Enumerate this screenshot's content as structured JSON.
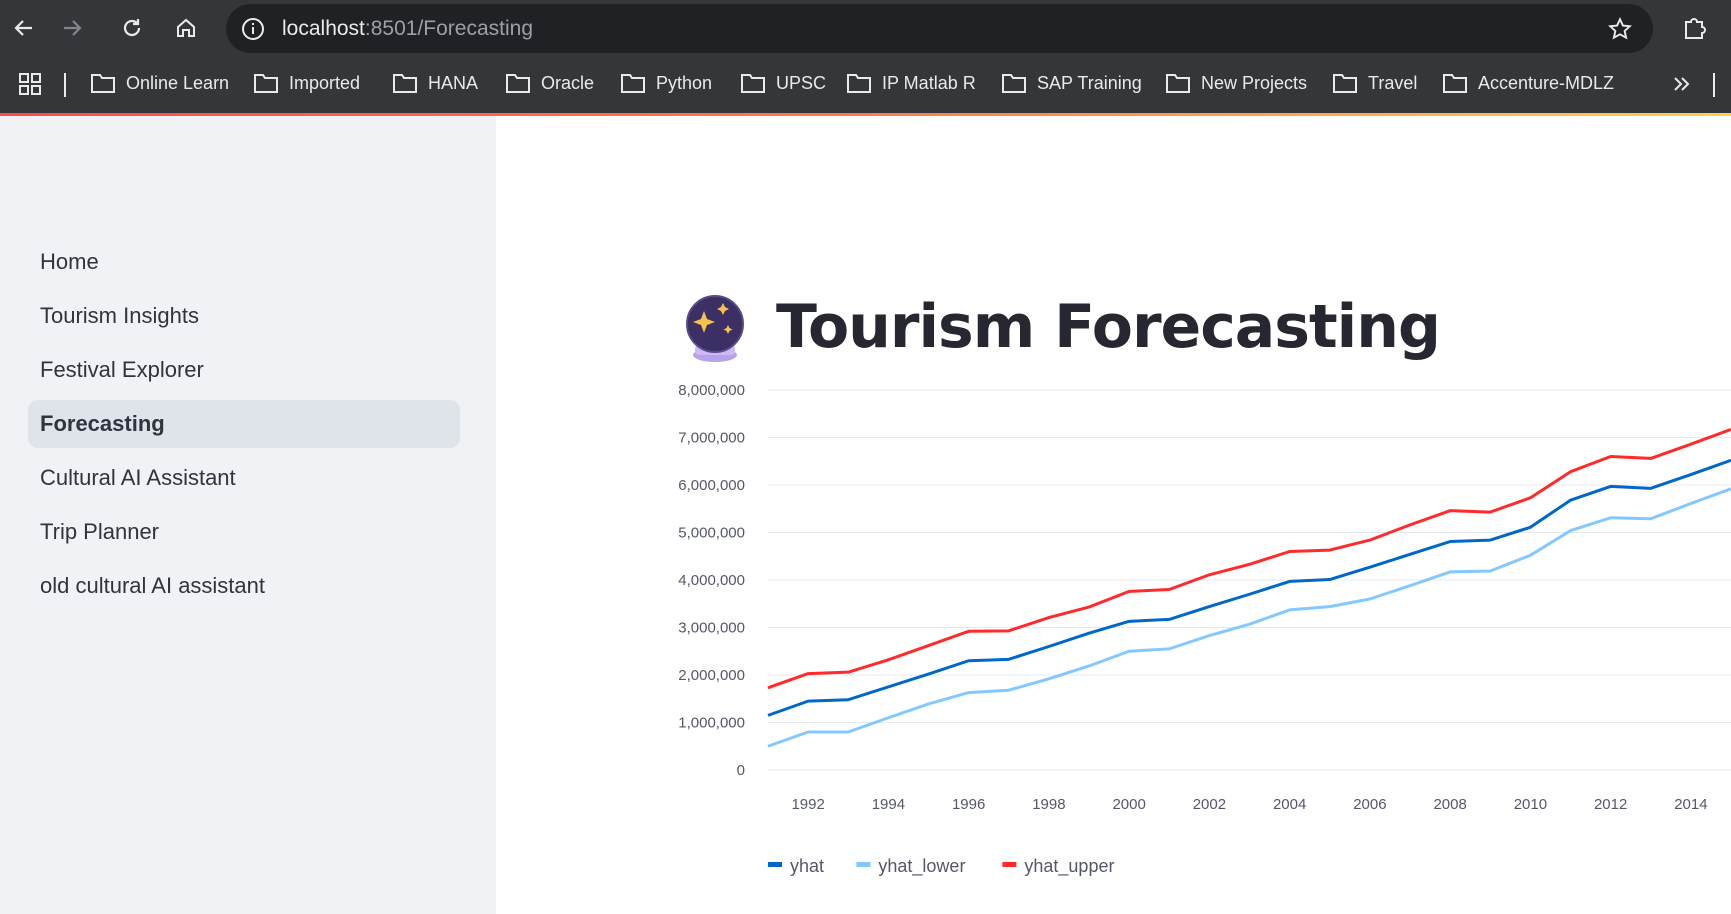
{
  "browser": {
    "url_host": "localhost",
    "url_rest": ":8501/Forecasting",
    "bookmarks": [
      "Online Learn",
      "Imported",
      "HANA",
      "Oracle",
      "Python",
      "UPSC",
      "IP Matlab R",
      "SAP Training",
      "New Projects",
      "Travel",
      "Accenture-MDLZ"
    ]
  },
  "sidebar": {
    "items": [
      {
        "label": "Home",
        "active": false
      },
      {
        "label": "Tourism Insights",
        "active": false
      },
      {
        "label": "Festival Explorer",
        "active": false
      },
      {
        "label": "Forecasting",
        "active": true
      },
      {
        "label": "Cultural AI Assistant",
        "active": false
      },
      {
        "label": "Trip Planner",
        "active": false
      },
      {
        "label": "old cultural AI assistant",
        "active": false
      }
    ]
  },
  "page": {
    "title": "Tourism Forecasting",
    "title_icon": "crystal-ball-icon"
  },
  "colors": {
    "yhat": "#0068c9",
    "yhat_lower": "#83c9ff",
    "yhat_upper": "#ff2b2b",
    "sidebar_bg": "#f0f2f6",
    "active_item_bg": "#dfe3ea"
  },
  "chart_data": {
    "type": "line",
    "x_ticks": [
      "1992",
      "1994",
      "1996",
      "1998",
      "2000",
      "2002",
      "2004",
      "2006",
      "2008",
      "2010",
      "2012",
      "2014"
    ],
    "y_ticks": [
      "0",
      "1,000,000",
      "2,000,000",
      "3,000,000",
      "4,000,000",
      "5,000,000",
      "6,000,000",
      "7,000,000",
      "8,000,000"
    ],
    "ylim": [
      0,
      8000000
    ],
    "xlim": [
      1991,
      2015
    ],
    "grid": true,
    "legend_position": "bottom-left",
    "x": [
      1991,
      1992,
      1993,
      1994,
      1995,
      1996,
      1997,
      1998,
      1999,
      2000,
      2001,
      2002,
      2003,
      2004,
      2005,
      2006,
      2007,
      2008,
      2009,
      2010,
      2011,
      2012,
      2013,
      2014,
      2015
    ],
    "series": [
      {
        "name": "yhat",
        "values": [
          1150000,
          1450000,
          1480000,
          1750000,
          2020000,
          2300000,
          2330000,
          2600000,
          2880000,
          3130000,
          3170000,
          3440000,
          3700000,
          3970000,
          4010000,
          4270000,
          4540000,
          4810000,
          4840000,
          5110000,
          5680000,
          5970000,
          5930000,
          6220000,
          6520000
        ]
      },
      {
        "name": "yhat_lower",
        "values": [
          500000,
          800000,
          800000,
          1100000,
          1390000,
          1630000,
          1680000,
          1920000,
          2190000,
          2500000,
          2550000,
          2830000,
          3070000,
          3370000,
          3440000,
          3600000,
          3880000,
          4170000,
          4190000,
          4520000,
          5040000,
          5310000,
          5290000,
          5610000,
          5920000
        ]
      },
      {
        "name": "yhat_upper",
        "values": [
          1730000,
          2030000,
          2060000,
          2320000,
          2620000,
          2920000,
          2930000,
          3210000,
          3430000,
          3760000,
          3800000,
          4110000,
          4330000,
          4600000,
          4630000,
          4840000,
          5160000,
          5460000,
          5430000,
          5730000,
          6280000,
          6600000,
          6560000,
          6860000,
          7170000
        ]
      }
    ]
  }
}
